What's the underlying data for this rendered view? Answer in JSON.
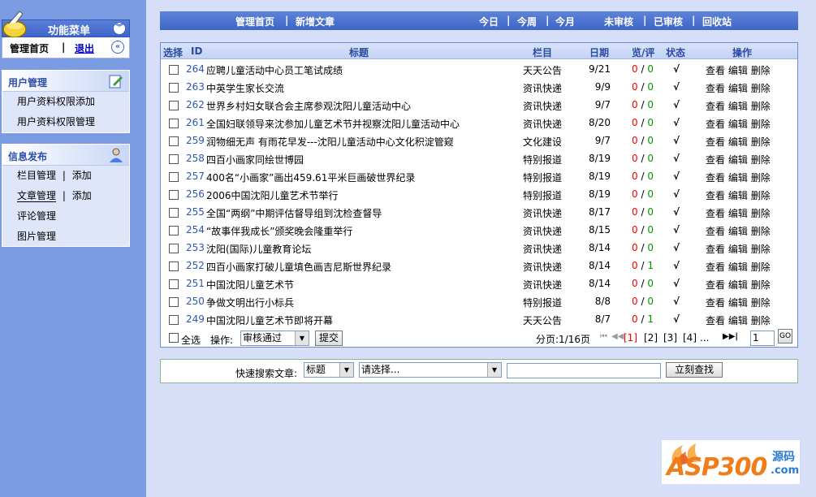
{
  "sidebar": {
    "menu_title": "功能菜单",
    "collapse_icon": "chevrons-down-icon",
    "home_label": "管理首页",
    "separator": "|",
    "logout_label": "退出",
    "back_icon": "chevrons-left-icon",
    "groups": [
      {
        "title": "用户管理",
        "icon": "edit-note-icon",
        "items": [
          {
            "label": "用户资料权限添加"
          },
          {
            "label": "用户资料权限管理"
          }
        ]
      },
      {
        "title": "信息发布",
        "icon": "user-icon",
        "items": [
          {
            "label": "栏目管理",
            "sep": "|",
            "extra": "添加"
          },
          {
            "label": "文章管理",
            "sep": "|",
            "extra": "添加"
          },
          {
            "label": "评论管理"
          },
          {
            "label": "图片管理"
          }
        ]
      }
    ]
  },
  "topnav": {
    "home": "管理首页",
    "new_article": "新增文章",
    "today": "今日",
    "week": "今周",
    "month": "今月",
    "unreviewed": "未审核",
    "reviewed": "已审核",
    "recycle": "回收站",
    "sep": "|"
  },
  "table": {
    "headers": {
      "select": "选择",
      "id": "ID",
      "title": "标题",
      "column": "栏目",
      "date": "日期",
      "views": "览/评",
      "status": "状态",
      "ops": "操作"
    },
    "ops": {
      "view": "查看",
      "edit": "编辑",
      "delete": "删除"
    },
    "views_sep": " / ",
    "rows": [
      {
        "id": "264",
        "title": "应聘儿童活动中心员工笔试成绩",
        "column": "天天公告",
        "date": "9/21",
        "views": "0",
        "comments": "0",
        "status": "√"
      },
      {
        "id": "263",
        "title": "中英学生家长交流",
        "column": "资讯快递",
        "date": "9/9",
        "views": "0",
        "comments": "0",
        "status": "√"
      },
      {
        "id": "262",
        "title": "世界乡村妇女联合会主席参观沈阳儿童活动中心",
        "column": "资讯快递",
        "date": "9/7",
        "views": "0",
        "comments": "0",
        "status": "√"
      },
      {
        "id": "261",
        "title": "全国妇联领导来沈参加儿童艺术节并视察沈阳儿童活动中心",
        "column": "资讯快递",
        "date": "8/20",
        "views": "0",
        "comments": "0",
        "status": "√"
      },
      {
        "id": "259",
        "title": "润物细无声 有雨花早发---沈阳儿童活动中心文化积淀管窥",
        "column": "文化建设",
        "date": "9/7",
        "views": "0",
        "comments": "0",
        "status": "√"
      },
      {
        "id": "258",
        "title": "四百小画家同绘世博园",
        "column": "特别报道",
        "date": "8/19",
        "views": "0",
        "comments": "0",
        "status": "√"
      },
      {
        "id": "257",
        "title": "400名“小画家”画出459.61平米巨画破世界纪录",
        "column": "特别报道",
        "date": "8/19",
        "views": "0",
        "comments": "0",
        "status": "√"
      },
      {
        "id": "256",
        "title": "2006中国沈阳儿童艺术节举行",
        "column": "特别报道",
        "date": "8/19",
        "views": "0",
        "comments": "0",
        "status": "√"
      },
      {
        "id": "255",
        "title": "全国“两纲”中期评估督导组到沈检查督导",
        "column": "资讯快递",
        "date": "8/17",
        "views": "0",
        "comments": "0",
        "status": "√"
      },
      {
        "id": "254",
        "title": "“故事伴我成长”颁奖晚会隆重举行",
        "column": "资讯快递",
        "date": "8/15",
        "views": "0",
        "comments": "0",
        "status": "√"
      },
      {
        "id": "253",
        "title": "沈阳(国际)儿童教育论坛",
        "column": "资讯快递",
        "date": "8/14",
        "views": "0",
        "comments": "0",
        "status": "√"
      },
      {
        "id": "252",
        "title": "四百小画家打破儿童填色画吉尼斯世界纪录",
        "column": "资讯快递",
        "date": "8/14",
        "views": "0",
        "comments": "1",
        "status": "√"
      },
      {
        "id": "251",
        "title": "中国沈阳儿童艺术节",
        "column": "资讯快递",
        "date": "8/14",
        "views": "0",
        "comments": "0",
        "status": "√"
      },
      {
        "id": "250",
        "title": "争做文明出行小标兵",
        "column": "特别报道",
        "date": "8/8",
        "views": "0",
        "comments": "0",
        "status": "√"
      },
      {
        "id": "249",
        "title": "中国沈阳儿童艺术节即将开幕",
        "column": "天天公告",
        "date": "8/7",
        "views": "0",
        "comments": "1",
        "status": "√"
      }
    ],
    "footer": {
      "select_all": "全选",
      "op_label": "操作:",
      "op_value": "审核通过",
      "submit": "提交",
      "page_label": "分页:1/16页",
      "first_icon": "first-page-icon",
      "prev_icon": "prev-page-icon",
      "pages": [
        "[1]",
        "[2]",
        "[3]",
        "[4]"
      ],
      "ellipsis": "...",
      "next_icon": "next-page-icon",
      "page_input": "1",
      "go": "GO"
    }
  },
  "search": {
    "label": "快速搜索文章:",
    "field_value": "标题",
    "category_value": "请选择...",
    "keyword_value": "",
    "button": "立刻查找"
  },
  "brand": {
    "name": "ASP300",
    "sub": "源码",
    "domain": ".com"
  },
  "colors": {
    "sidebar_bg": "#7b9be3",
    "nav_blue": "#3f65c7",
    "page_bg": "#d6dff7",
    "id_blue": "#2e56b5",
    "views_red": "#ee0000",
    "comments_green": "#009900",
    "brand_orange": "#f07d1a",
    "brand_blue": "#2a7bd6"
  }
}
